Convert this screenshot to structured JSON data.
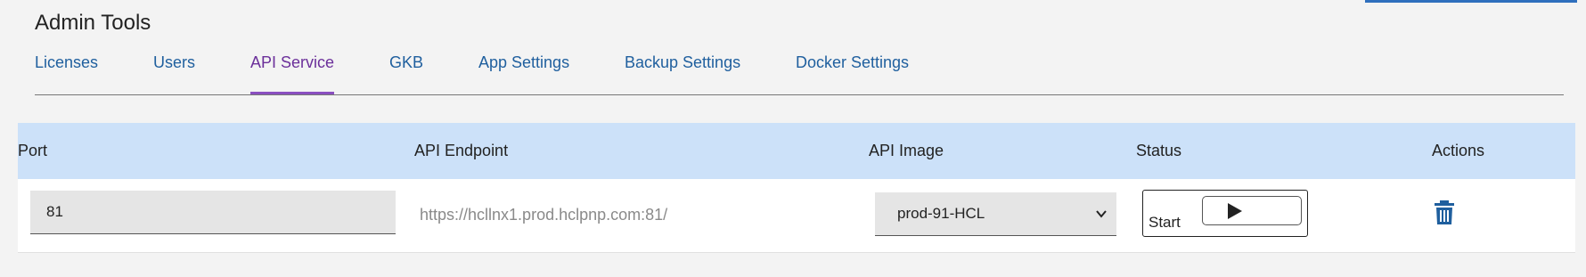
{
  "page_title": "Admin Tools",
  "tabs": [
    {
      "label": "Licenses",
      "active": false
    },
    {
      "label": "Users",
      "active": false
    },
    {
      "label": "API Service",
      "active": true
    },
    {
      "label": "GKB",
      "active": false
    },
    {
      "label": "App Settings",
      "active": false
    },
    {
      "label": "Backup Settings",
      "active": false
    },
    {
      "label": "Docker Settings",
      "active": false
    }
  ],
  "table": {
    "headers": {
      "port": "Port",
      "endpoint": "API Endpoint",
      "image": "API Image",
      "status": "Status",
      "actions": "Actions"
    },
    "rows": [
      {
        "port": "81",
        "endpoint": "https://hcllnx1.prod.hclpnp.com:81/",
        "image": "prod-91-HCL",
        "status_label": "Start",
        "status_button_icon": "play-icon",
        "action_icon": "trash-icon"
      }
    ]
  },
  "colors": {
    "accent_link": "#1f5f9e",
    "active_tab": "#6b2f9a",
    "header_bg": "#cce1f9",
    "trash_icon": "#1f5f9e"
  }
}
